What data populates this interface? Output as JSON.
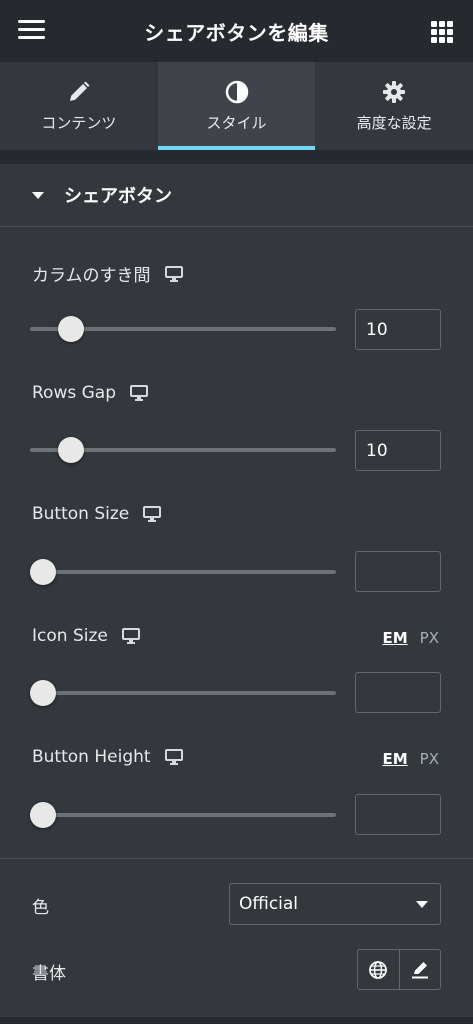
{
  "header": {
    "title": "シェアボタンを編集",
    "menu_icon": "hamburger-icon",
    "apps_icon": "grid-icon"
  },
  "tabs": [
    {
      "label": "コンテンツ",
      "icon": "pencil-icon",
      "active": false
    },
    {
      "label": "スタイル",
      "icon": "contrast-icon",
      "active": true
    },
    {
      "label": "高度な設定",
      "icon": "gear-icon",
      "active": false
    }
  ],
  "section": {
    "title": "シェアボタン"
  },
  "controls": {
    "column_gap": {
      "label": "カラムのすき間",
      "value": "10",
      "slider_percent": 10
    },
    "rows_gap": {
      "label": "Rows Gap",
      "value": "10",
      "slider_percent": 10
    },
    "button_size": {
      "label": "Button Size",
      "value": "",
      "slider_percent": 0
    },
    "icon_size": {
      "label": "Icon Size",
      "value": "",
      "slider_percent": 0,
      "unit_em": "EM",
      "unit_px": "PX"
    },
    "button_height": {
      "label": "Button Height",
      "value": "",
      "slider_percent": 0,
      "unit_em": "EM",
      "unit_px": "PX"
    }
  },
  "color": {
    "label": "色",
    "selected": "Official"
  },
  "typography": {
    "label": "書体"
  },
  "colors": {
    "accent": "#71d7f7",
    "panel": "#34383c",
    "background": "#26292e"
  }
}
